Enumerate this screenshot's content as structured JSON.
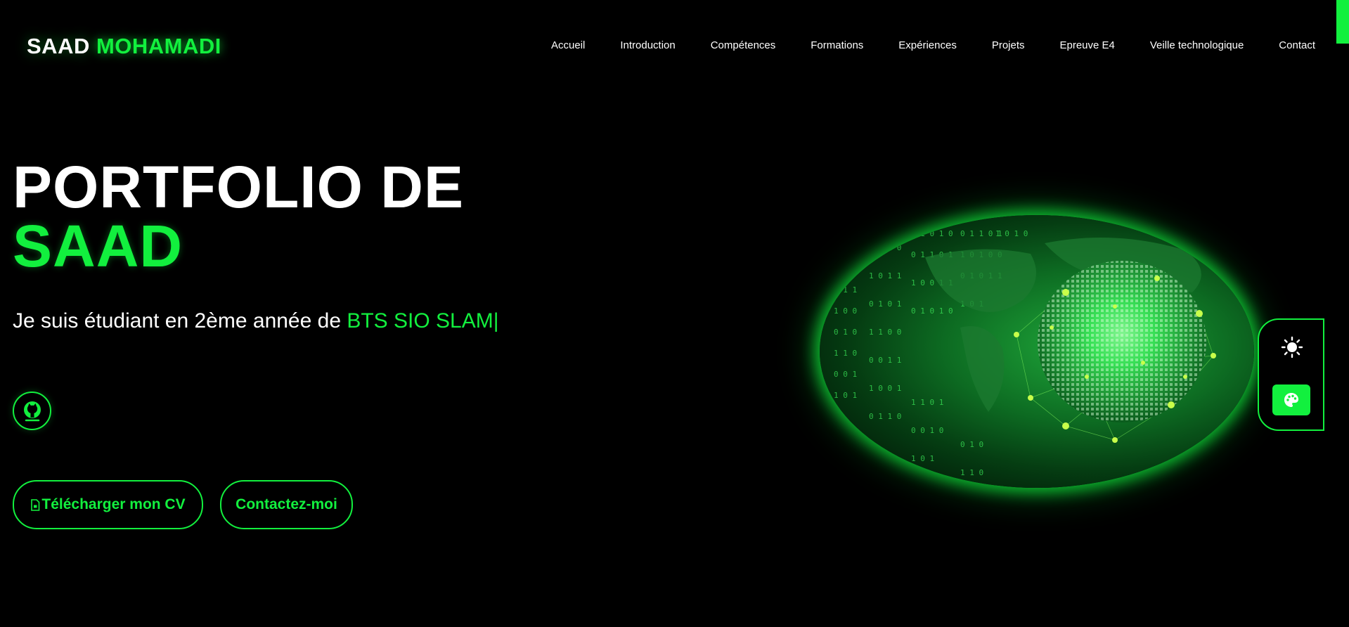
{
  "header": {
    "logo_first": "SAAD",
    "logo_last": "MOHAMADI",
    "nav": [
      {
        "label": "Accueil"
      },
      {
        "label": "Introduction"
      },
      {
        "label": "Compétences"
      },
      {
        "label": "Formations"
      },
      {
        "label": "Expériences"
      },
      {
        "label": "Projets"
      },
      {
        "label": "Epreuve E4"
      },
      {
        "label": "Veille technologique"
      },
      {
        "label": "Contact"
      }
    ]
  },
  "hero": {
    "title_line1": "PORTFOLIO DE",
    "title_line2": "SAAD",
    "subtitle_prefix": "Je suis étudiant en 2ème année de ",
    "subtitle_accent": "BTS SIO SLAM",
    "cursor": "|",
    "cv_button": "Télécharger mon CV",
    "contact_button": "Contactez-moi"
  },
  "icons": {
    "github": "github-icon",
    "file": "file-icon",
    "sun": "sun-icon",
    "palette": "palette-icon"
  },
  "colors": {
    "accent": "#12f03e",
    "background": "#000000",
    "text": "#ffffff"
  }
}
